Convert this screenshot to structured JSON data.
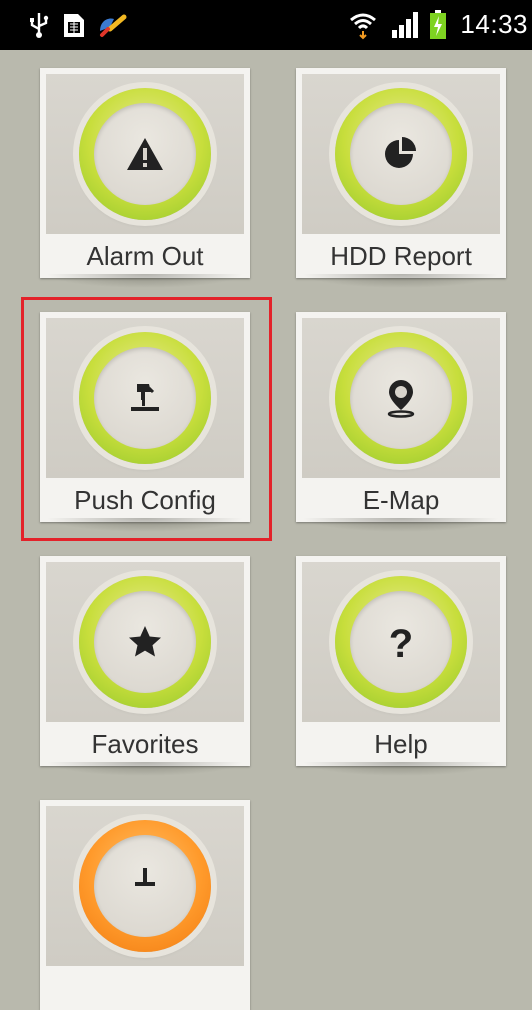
{
  "status_bar": {
    "time": "14:33",
    "icons": [
      "usb-icon",
      "sim-card-icon",
      "android-debug-icon",
      "wifi-icon",
      "signal-icon",
      "battery-charging-icon"
    ]
  },
  "tiles": [
    {
      "label": "Alarm Out",
      "icon": "warning-icon"
    },
    {
      "label": "HDD Report",
      "icon": "pie-chart-icon"
    },
    {
      "label": "Push Config",
      "icon": "push-pin-icon"
    },
    {
      "label": "E-Map",
      "icon": "map-pin-icon"
    },
    {
      "label": "Favorites",
      "icon": "star-icon"
    },
    {
      "label": "Help",
      "icon": "question-icon"
    },
    {
      "label": "",
      "icon": "partial-icon"
    }
  ],
  "colors": {
    "ring_green": "#c8de3c",
    "ring_orange": "#ff9a2b",
    "highlight": "#e3222a",
    "background": "#b9b9ad"
  }
}
